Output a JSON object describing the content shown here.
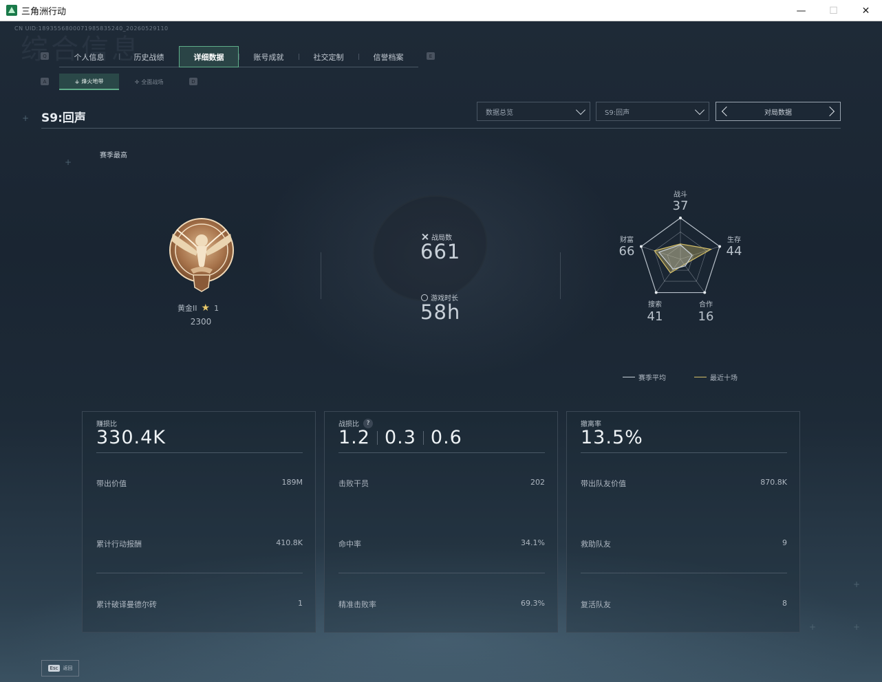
{
  "window": {
    "title": "三角洲行动",
    "minimize": "—",
    "maximize": "☐",
    "close": "✕"
  },
  "uid": "CN UID:1893556800071985835240_20260529110",
  "background_text": "综合信息",
  "tabs": {
    "left_key": "Q",
    "right_key": "E",
    "items": [
      {
        "label": "个人信息"
      },
      {
        "label": "历史战绩"
      },
      {
        "label": "详细数据",
        "active": true
      },
      {
        "label": "账号成就"
      },
      {
        "label": "社交定制"
      },
      {
        "label": "信誉档案"
      }
    ]
  },
  "subtabs": {
    "left_key": "A",
    "right_key": "D",
    "items": [
      {
        "label": "烽火地带",
        "active": true
      },
      {
        "label": "全面战场"
      }
    ]
  },
  "season_title": "S9:回声",
  "filters": {
    "overview": "数据总览",
    "season": "S9:回声",
    "pager_label": "对局数据"
  },
  "season_best_label": "赛季最高",
  "rank": {
    "name": "黄金II",
    "stars": "1",
    "points": "2300",
    "medal_numeral": "II"
  },
  "stats": {
    "matches_label": "战局数",
    "matches_value": "661",
    "playtime_label": "游戏时长",
    "playtime_value": "58h"
  },
  "radar": {
    "axes": [
      {
        "label": "战斗",
        "value": "37"
      },
      {
        "label": "生存",
        "value": "44"
      },
      {
        "label": "合作",
        "value": "16"
      },
      {
        "label": "搜索",
        "value": "41"
      },
      {
        "label": "财富",
        "value": "66"
      }
    ],
    "season_avg_ratios": [
      0.35,
      0.3,
      0.2,
      0.3,
      0.55
    ],
    "recent_ratios": [
      0.37,
      0.78,
      0.16,
      0.41,
      0.66
    ],
    "legend": {
      "season_avg": "赛季平均",
      "recent_ten": "最近十场"
    },
    "colors": {
      "season_avg": "#c9d1d9",
      "recent_ten": "#d6c169"
    }
  },
  "cards": [
    {
      "label": "赚损比",
      "values": [
        "330.4K"
      ],
      "rows": [
        {
          "label": "带出价值",
          "value": "189M"
        },
        {
          "label": "累计行动报酬",
          "value": "410.8K"
        },
        {
          "label": "累计破译曼德尔砖",
          "value": "1"
        }
      ]
    },
    {
      "label": "战损比",
      "help": "?",
      "values": [
        "1.2",
        "0.3",
        "0.6"
      ],
      "rows": [
        {
          "label": "击败干员",
          "value": "202"
        },
        {
          "label": "命中率",
          "value": "34.1%"
        },
        {
          "label": "精准击败率",
          "value": "69.3%"
        }
      ]
    },
    {
      "label": "撤离率",
      "values": [
        "13.5%"
      ],
      "rows": [
        {
          "label": "带出队友价值",
          "value": "870.8K"
        },
        {
          "label": "救助队友",
          "value": "9"
        },
        {
          "label": "复活队友",
          "value": "8"
        }
      ]
    }
  ],
  "footer": {
    "key": "Esc",
    "label": "返回"
  }
}
